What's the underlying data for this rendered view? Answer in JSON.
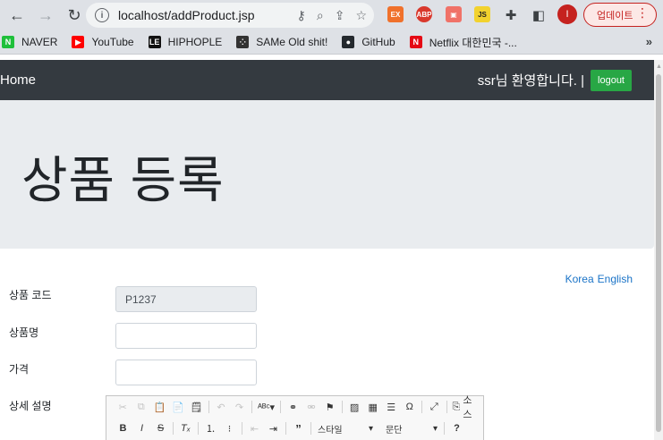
{
  "browser": {
    "url": "localhost/addProduct.jsp",
    "update_label": "업데이트",
    "avatar_letter": "I",
    "extensions": [
      {
        "name": "ex-extension",
        "label": "EX",
        "color": "#f0712b"
      },
      {
        "name": "abp-extension",
        "label": "ABP",
        "color": "#d9382c"
      },
      {
        "name": "screen-extension",
        "label": "▣",
        "color": "#f07268"
      },
      {
        "name": "js-extension",
        "label": "JS",
        "color": "#f2d22e"
      }
    ]
  },
  "bookmarks": [
    {
      "name": "naver",
      "label": "NAVER",
      "icon_text": "N",
      "color": "#1fc03b"
    },
    {
      "name": "youtube",
      "label": "YouTube",
      "icon_text": "▶",
      "color": "#ff0000"
    },
    {
      "name": "hiphople",
      "label": "HIPHOPLE",
      "icon_text": "LE",
      "color": "#111111"
    },
    {
      "name": "same-old-shit",
      "label": "SAMe Old shit!",
      "icon_text": "⁘",
      "color": "#333333"
    },
    {
      "name": "github",
      "label": "GitHub",
      "icon_text": "●",
      "color": "#24292e"
    },
    {
      "name": "netflix",
      "label": "Netflix 대한민국 -...",
      "icon_text": "N",
      "color": "#e50914"
    }
  ],
  "navbar": {
    "brand": "Home",
    "welcome": "ssr님 환영합니다. |",
    "logout": "logout"
  },
  "jumbotron": {
    "title": "상품 등록"
  },
  "lang": {
    "korea": "Korea",
    "english": "English"
  },
  "form": {
    "code_label": "상품 코드",
    "code_value": "P1237",
    "name_label": "상품명",
    "name_value": "",
    "price_label": "가격",
    "price_value": "",
    "desc_label": "상세 설명"
  },
  "editor": {
    "source_label": "소스",
    "style_label": "스타일",
    "format_label": "문단"
  }
}
